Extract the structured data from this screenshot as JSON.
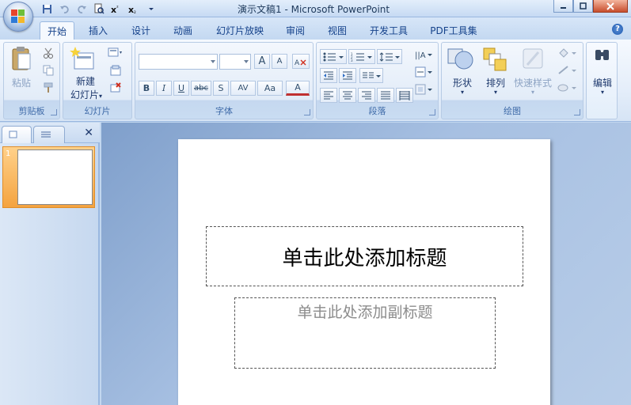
{
  "window": {
    "title": "演示文稿1 - Microsoft PowerPoint"
  },
  "qat": {
    "items": [
      "save-icon",
      "undo-icon",
      "redo-icon",
      "print-preview-icon",
      "format-icon",
      "close-doc-icon",
      "customize-dropdown-icon"
    ]
  },
  "tabs": [
    {
      "label": "开始",
      "active": true
    },
    {
      "label": "插入"
    },
    {
      "label": "设计"
    },
    {
      "label": "动画"
    },
    {
      "label": "幻灯片放映"
    },
    {
      "label": "审阅"
    },
    {
      "label": "视图"
    },
    {
      "label": "开发工具"
    },
    {
      "label": "PDF工具集"
    }
  ],
  "ribbon": {
    "clipboard": {
      "label": "剪贴板",
      "paste": "粘贴"
    },
    "slides": {
      "label": "幻灯片",
      "new_slide_line1": "新建",
      "new_slide_line2": "幻灯片"
    },
    "font": {
      "label": "字体",
      "buttons": [
        "B",
        "I",
        "U",
        "abc",
        "S",
        "AV",
        "Aa",
        "A"
      ],
      "grow": "A",
      "shrink": "A"
    },
    "paragraph": {
      "label": "段落"
    },
    "drawing": {
      "label": "绘图",
      "shapes": "形状",
      "arrange": "排列",
      "quick_styles": "快速样式"
    },
    "editing": {
      "label": "编辑"
    }
  },
  "slide": {
    "number": "1",
    "title_placeholder": "单击此处添加标题",
    "subtitle_placeholder": "单击此处添加副标题"
  },
  "colors": {
    "ribbon_text": "#15428b",
    "thumb_highlight": "#f4a340",
    "canvas_bg": "#a7c0e2"
  }
}
